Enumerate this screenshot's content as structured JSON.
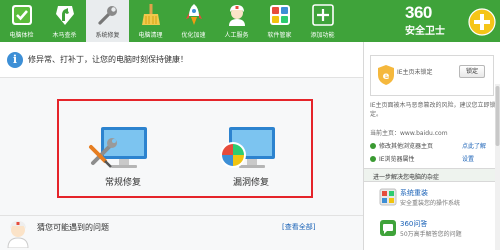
{
  "header": {
    "tabs": [
      {
        "label": "电脑体检",
        "icon": "computer-check-icon"
      },
      {
        "label": "木马查杀",
        "icon": "horse-icon"
      },
      {
        "label": "系统修复",
        "icon": "wrench-icon",
        "active": true
      },
      {
        "label": "电脑清理",
        "icon": "broom-icon"
      },
      {
        "label": "优化加速",
        "icon": "rocket-icon"
      },
      {
        "label": "人工服务",
        "icon": "doctor-icon"
      },
      {
        "label": "软件管家",
        "icon": "apps-icon"
      },
      {
        "label": "添加功能",
        "icon": "plus-icon"
      }
    ],
    "brand_line1": "360",
    "brand_line2": "安全卫士"
  },
  "tip": {
    "text": "修异常、打补丁，让您的电脑时刻保持健康！"
  },
  "main": {
    "fix_buttons": [
      {
        "label": "常规修复",
        "icon": "monitor-wrench-icon"
      },
      {
        "label": "漏洞修复",
        "icon": "monitor-windows-icon"
      }
    ],
    "problem_title": "猜您可能遇到的问题",
    "problem_link": "[查看全部]"
  },
  "sidebar": {
    "home_status": "IE主页未锁定",
    "lock_label": "锁定",
    "description": "IE主页面被木马恶意篡改的风险，建议您立即锁定。",
    "current_url": "当前主页：www.baidu.com",
    "options": [
      {
        "text": "修改其他浏览器主页",
        "link": "点此了解"
      },
      {
        "text": "IE浏览器属性",
        "link": "设置"
      }
    ],
    "more_title": "进一步解决您电脑的杂症",
    "tools": [
      {
        "name": "系统重装",
        "desc": "安全重装您的操作系统",
        "icon": "reinstall-icon"
      },
      {
        "name": "360问答",
        "desc": "50万高手解答您的问题",
        "icon": "qa-icon"
      }
    ]
  },
  "colors": {
    "header_green": "#3fa33a",
    "highlight_red": "#e5242a",
    "link_blue": "#1a62b7"
  }
}
